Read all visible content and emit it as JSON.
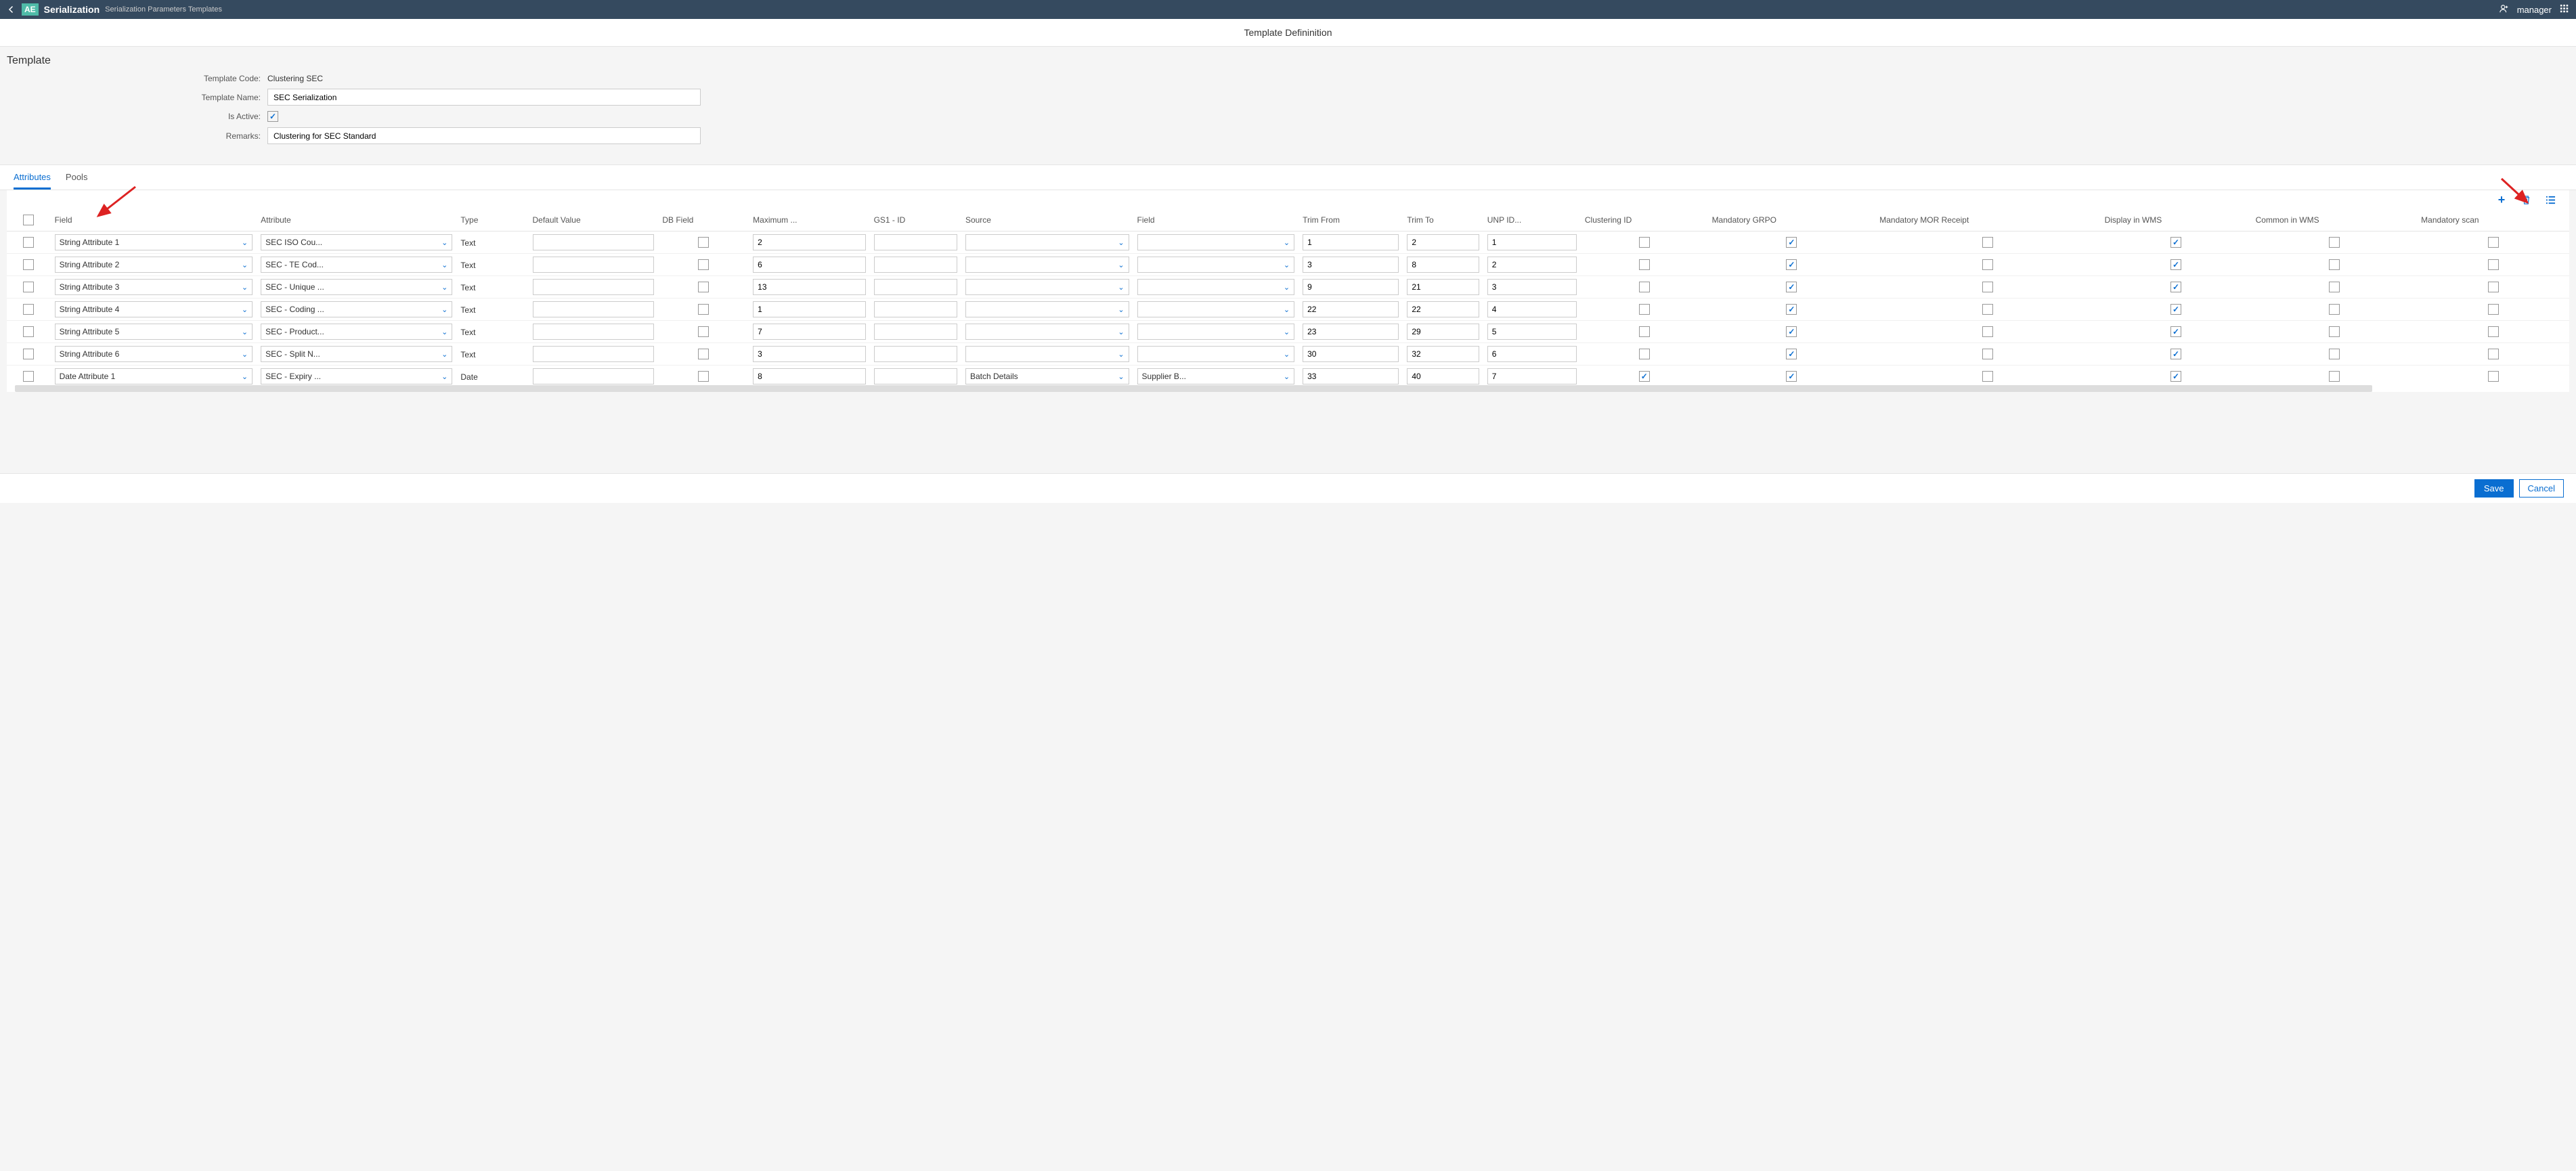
{
  "topbar": {
    "logo": "AE",
    "app": "Serialization",
    "breadcrumb": "Serialization Parameters Templates",
    "user": "manager"
  },
  "page_title": "Template Defininition",
  "template": {
    "heading": "Template",
    "labels": {
      "code": "Template Code:",
      "name": "Template Name:",
      "active": "Is Active:",
      "remarks": "Remarks:"
    },
    "code_value": "Clustering SEC",
    "name_value": "SEC Serialization",
    "active_checked": true,
    "remarks_value": "Clustering for SEC Standard"
  },
  "tabs": {
    "attributes": "Attributes",
    "pools": "Pools"
  },
  "grid": {
    "headers": {
      "field": "Field",
      "attribute": "Attribute",
      "type": "Type",
      "default": "Default Value",
      "dbfield": "DB Field",
      "maximum": "Maximum ...",
      "gs1": "GS1 - ID",
      "source": "Source",
      "field2": "Field",
      "trimfrom": "Trim From",
      "trimto": "Trim To",
      "unp": "UNP ID...",
      "clustering": "Clustering ID",
      "mgrpo": "Mandatory GRPO",
      "mmor": "Mandatory MOR Receipt",
      "dwms": "Display in WMS",
      "cwms": "Common in WMS",
      "mscan": "Mandatory scan"
    },
    "rows": [
      {
        "field": "String Attribute 1",
        "attr": "SEC ISO Cou...",
        "type": "Text",
        "def": "",
        "db": false,
        "max": "2",
        "gs1": "",
        "src": "",
        "field2": "",
        "trimf": "1",
        "trimt": "2",
        "unp": "1",
        "clust": false,
        "mgrpo": true,
        "mmor": false,
        "dwms": true,
        "cwms": false,
        "mscan": false
      },
      {
        "field": "String Attribute 2",
        "attr": "SEC - TE Cod...",
        "type": "Text",
        "def": "",
        "db": false,
        "max": "6",
        "gs1": "",
        "src": "",
        "field2": "",
        "trimf": "3",
        "trimt": "8",
        "unp": "2",
        "clust": false,
        "mgrpo": true,
        "mmor": false,
        "dwms": true,
        "cwms": false,
        "mscan": false
      },
      {
        "field": "String Attribute 3",
        "attr": "SEC - Unique ...",
        "type": "Text",
        "def": "",
        "db": false,
        "max": "13",
        "gs1": "",
        "src": "",
        "field2": "",
        "trimf": "9",
        "trimt": "21",
        "unp": "3",
        "clust": false,
        "mgrpo": true,
        "mmor": false,
        "dwms": true,
        "cwms": false,
        "mscan": false
      },
      {
        "field": "String Attribute 4",
        "attr": "SEC - Coding ...",
        "type": "Text",
        "def": "",
        "db": false,
        "max": "1",
        "gs1": "",
        "src": "",
        "field2": "",
        "trimf": "22",
        "trimt": "22",
        "unp": "4",
        "clust": false,
        "mgrpo": true,
        "mmor": false,
        "dwms": true,
        "cwms": false,
        "mscan": false
      },
      {
        "field": "String Attribute 5",
        "attr": "SEC - Product...",
        "type": "Text",
        "def": "",
        "db": false,
        "max": "7",
        "gs1": "",
        "src": "",
        "field2": "",
        "trimf": "23",
        "trimt": "29",
        "unp": "5",
        "clust": false,
        "mgrpo": true,
        "mmor": false,
        "dwms": true,
        "cwms": false,
        "mscan": false
      },
      {
        "field": "String Attribute 6",
        "attr": "SEC - Split N...",
        "type": "Text",
        "def": "",
        "db": false,
        "max": "3",
        "gs1": "",
        "src": "",
        "field2": "",
        "trimf": "30",
        "trimt": "32",
        "unp": "6",
        "clust": false,
        "mgrpo": true,
        "mmor": false,
        "dwms": true,
        "cwms": false,
        "mscan": false
      },
      {
        "field": "Date Attribute 1",
        "attr": "SEC - Expiry ...",
        "type": "Date",
        "def": "",
        "db": false,
        "max": "8",
        "gs1": "",
        "src": "Batch Details",
        "field2": "Supplier B...",
        "trimf": "33",
        "trimt": "40",
        "unp": "7",
        "clust": true,
        "mgrpo": true,
        "mmor": false,
        "dwms": true,
        "cwms": false,
        "mscan": false
      }
    ]
  },
  "footer": {
    "save": "Save",
    "cancel": "Cancel"
  }
}
